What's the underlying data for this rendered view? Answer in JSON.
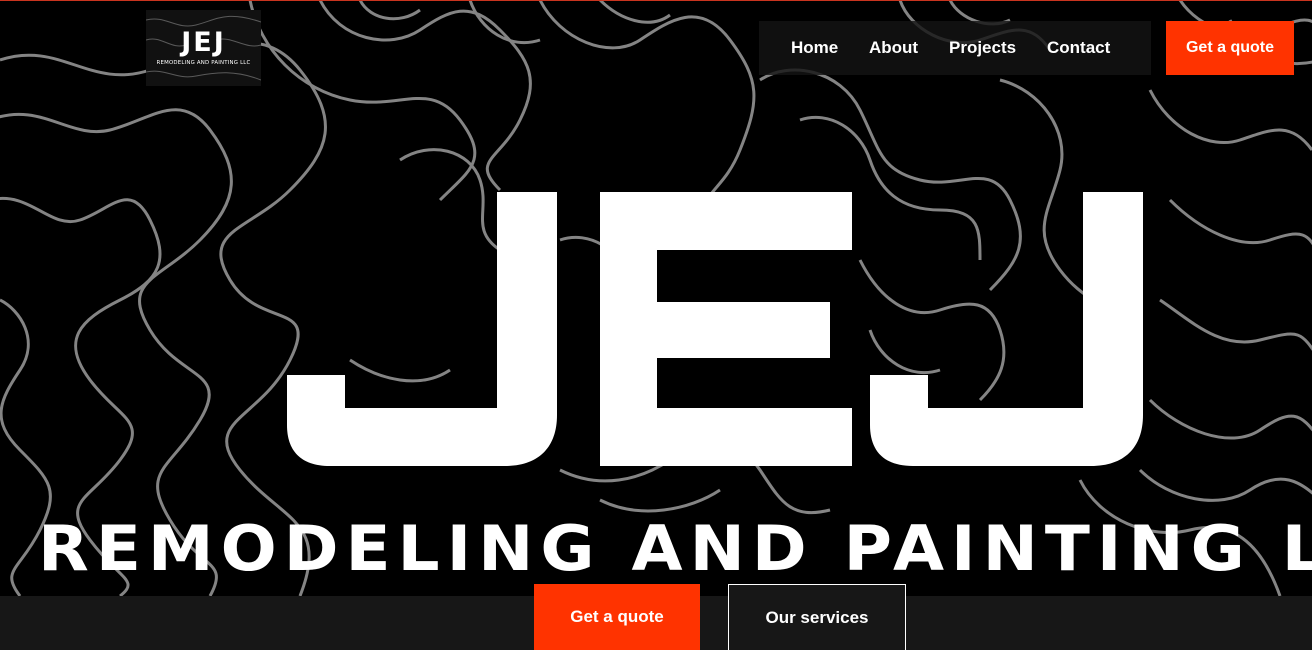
{
  "header": {
    "logo": {
      "mark": "JEJ",
      "subtitle": "REMODELING AND PAINTING LLC"
    },
    "nav": [
      {
        "label": "Home"
      },
      {
        "label": "About"
      },
      {
        "label": "Projects"
      },
      {
        "label": "Contact"
      }
    ],
    "cta_label": "Get a quote"
  },
  "hero": {
    "mark": "JEJ",
    "subtitle": "REMODELING AND PAINTING LLC"
  },
  "actions": {
    "primary_label": "Get a quote",
    "secondary_label": "Our services"
  },
  "colors": {
    "accent": "#ff3300",
    "background": "#000000",
    "contour": "#8a8a8a",
    "bar": "#171717"
  }
}
